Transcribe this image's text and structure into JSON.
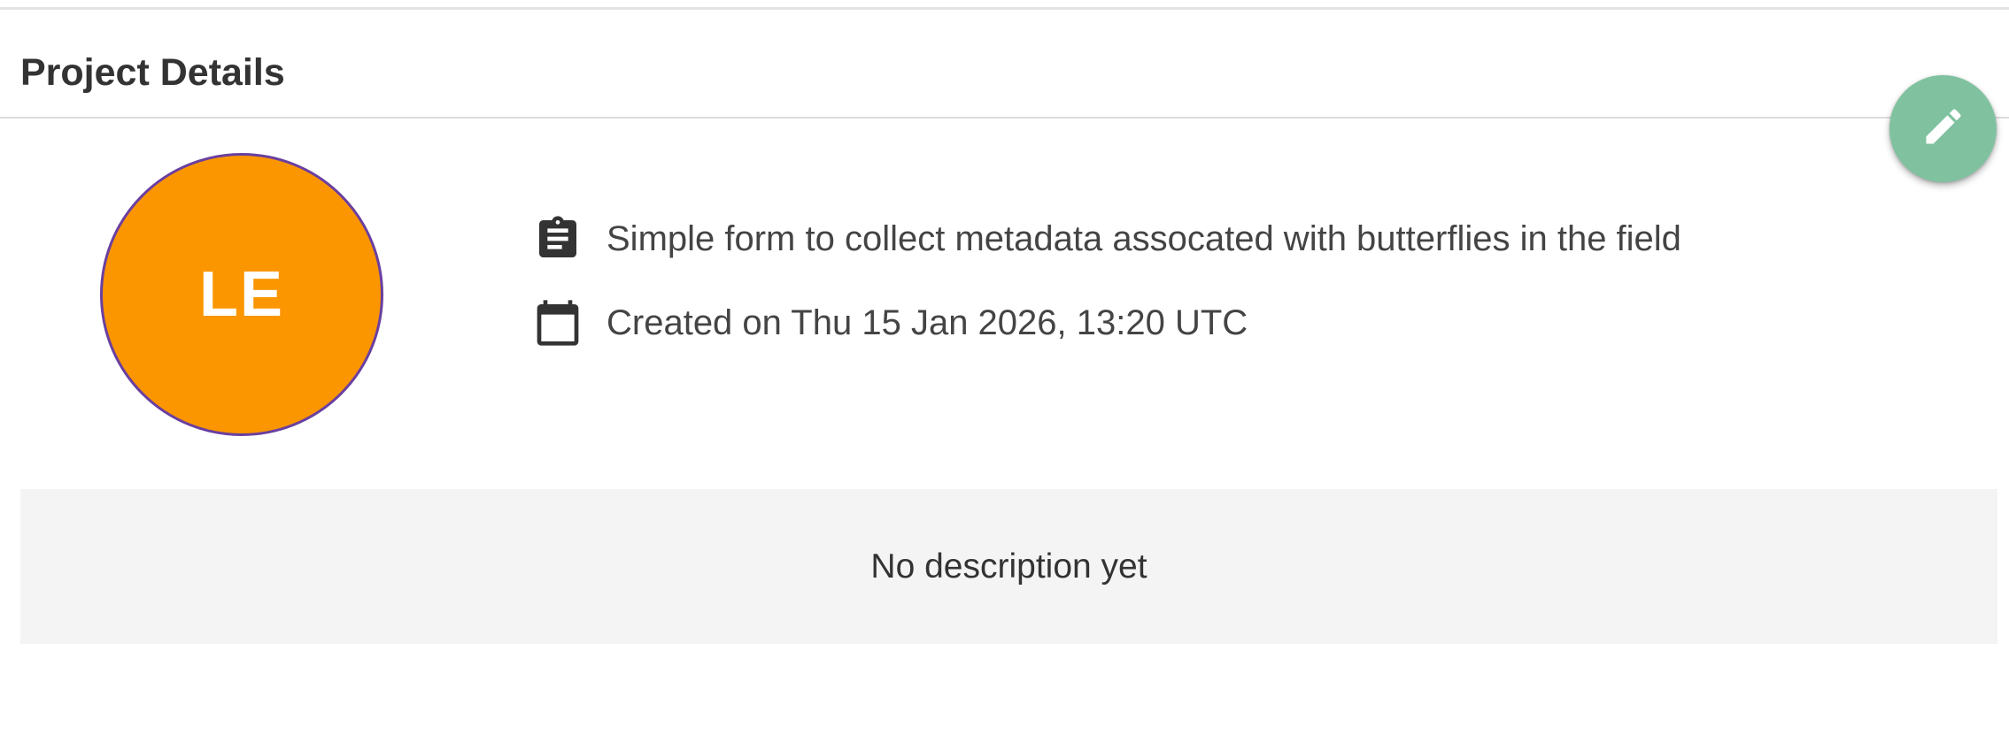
{
  "card": {
    "title": "Project Details"
  },
  "edit_button": {
    "icon": "pencil-icon",
    "color": "#80c2a0"
  },
  "avatar": {
    "initials": "LE",
    "background": "#fb9600",
    "border": "#6a3fa0"
  },
  "meta": {
    "summary": {
      "icon": "clipboard-icon",
      "text": "Simple form to collect metadata assocated with butterflies in the field"
    },
    "created": {
      "icon": "calendar-icon",
      "text": "Created on Thu 15 Jan 2026, 13:20 UTC"
    }
  },
  "description": {
    "text": "No description yet"
  }
}
